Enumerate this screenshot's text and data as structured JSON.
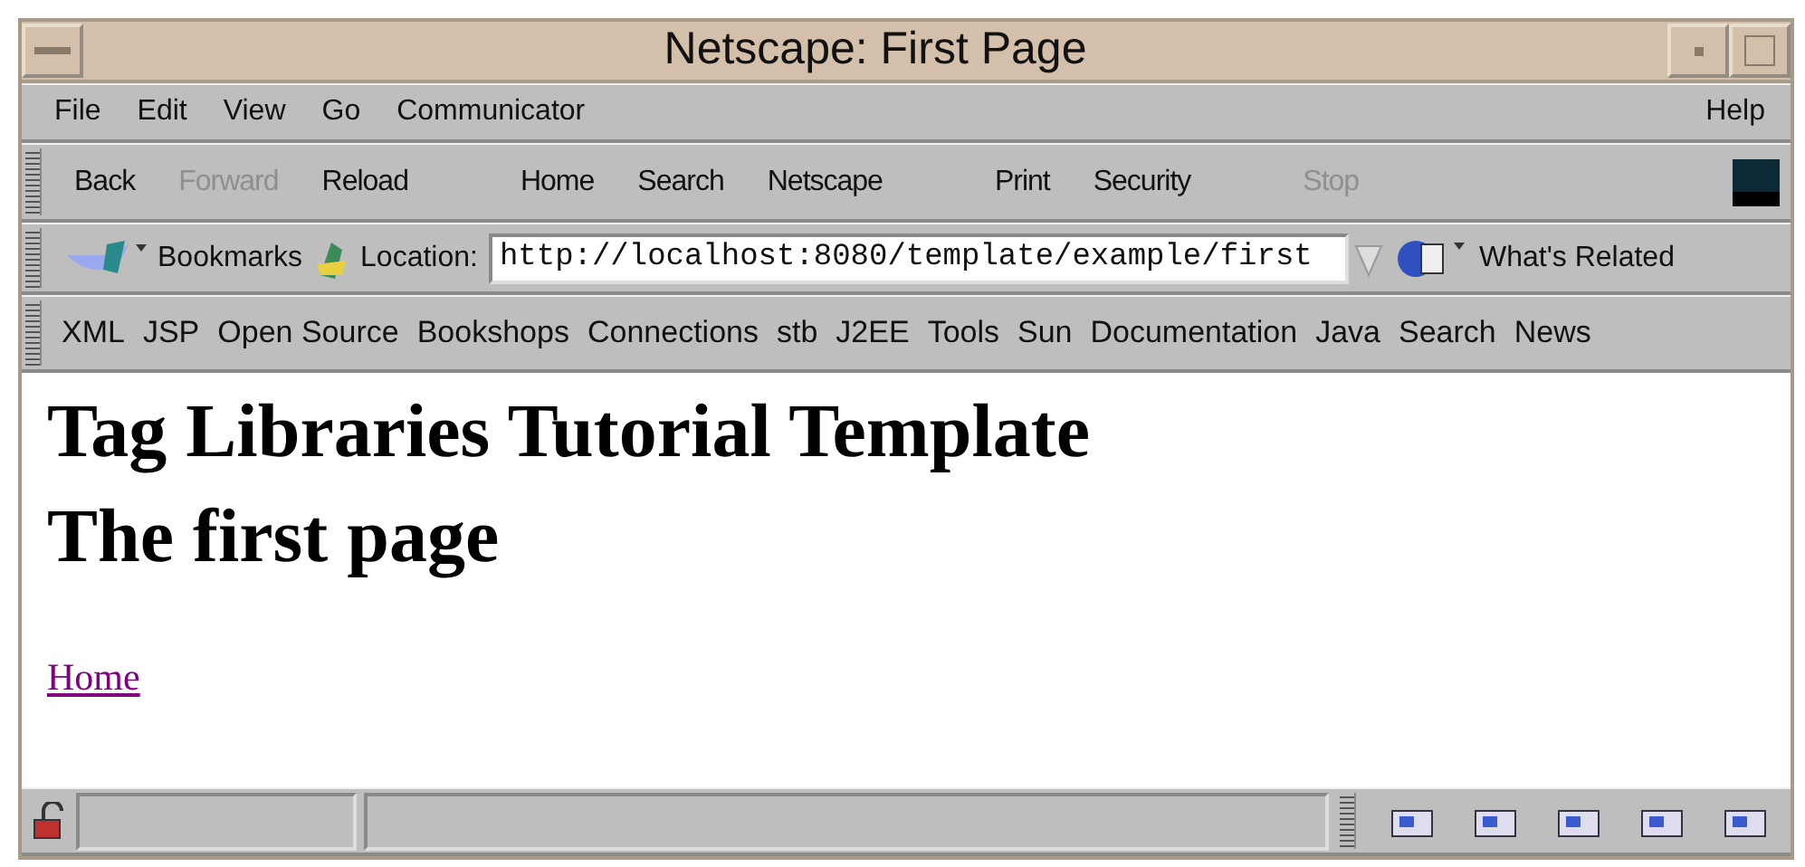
{
  "window": {
    "title": "Netscape: First Page"
  },
  "menu": {
    "left": [
      {
        "label": "File"
      },
      {
        "label": "Edit"
      },
      {
        "label": "View"
      },
      {
        "label": "Go"
      },
      {
        "label": "Communicator"
      }
    ],
    "right": [
      {
        "label": "Help"
      }
    ]
  },
  "toolbar": {
    "buttons": [
      {
        "label": "Back",
        "disabled": false,
        "gap": false
      },
      {
        "label": "Forward",
        "disabled": true,
        "gap": false
      },
      {
        "label": "Reload",
        "disabled": false,
        "gap": false
      },
      {
        "label": "Home",
        "disabled": false,
        "gap": true
      },
      {
        "label": "Search",
        "disabled": false,
        "gap": false
      },
      {
        "label": "Netscape",
        "disabled": false,
        "gap": false
      },
      {
        "label": "Print",
        "disabled": false,
        "gap": true
      },
      {
        "label": "Security",
        "disabled": false,
        "gap": false
      },
      {
        "label": "Stop",
        "disabled": true,
        "gap": true
      }
    ]
  },
  "location_bar": {
    "bookmarks": "Bookmarks",
    "location_label": "Location:",
    "url": "http://localhost:8080/template/example/first",
    "related": "What's Related"
  },
  "personal_bar": [
    "XML",
    "JSP",
    "Open Source",
    "Bookshops",
    "Connections",
    "stb",
    "J2EE",
    "Tools",
    "Sun",
    "Documentation",
    "Java",
    "Search",
    "News"
  ],
  "content": {
    "headings": [
      "Tag Libraries Tutorial Template",
      "The first page"
    ],
    "link": "Home"
  }
}
